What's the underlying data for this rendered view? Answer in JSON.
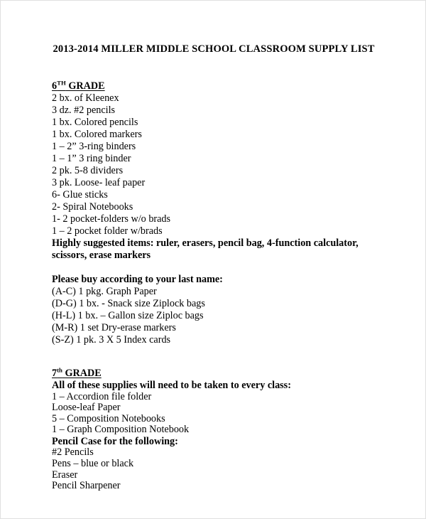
{
  "document": {
    "title": "2013-2014 MILLER MIDDLE SCHOOL CLASSROOM SUPPLY LIST",
    "sections": [
      {
        "id": "grade-6",
        "heading_number": "6",
        "heading_suffix": "TH",
        "heading_word": " GRADE",
        "items": [
          "2 bx. of Kleenex",
          "3 dz. #2 pencils",
          "1 bx. Colored pencils",
          "1 bx. Colored markers",
          "1 – 2” 3-ring binders",
          "1 – 1” 3 ring binder",
          "2 pk. 5-8 dividers",
          "3 pk. Loose- leaf paper",
          "6- Glue sticks",
          "2- Spiral Notebooks",
          "1- 2 pocket-folders w/o brads",
          "1 – 2 pocket folder w/brads"
        ],
        "suggested_note": "Highly suggested items: ruler, erasers, pencil bag, 4-function calculator, scissors, erase markers",
        "last_name_heading": "Please buy according to your last name:",
        "last_name_items": [
          "(A-C) 1 pkg. Graph Paper",
          "(D-G) 1 bx. - Snack size Ziplock bags",
          "(H-L) 1 bx. – Gallon size Ziploc bags",
          "(M-R) 1 set Dry-erase markers",
          "(S-Z) 1 pk. 3 X 5 Index cards"
        ]
      },
      {
        "id": "grade-7",
        "heading_number": "7",
        "heading_suffix": "th",
        "heading_word": " GRADE",
        "intro_note": "All of these supplies will need to be taken to every class:",
        "items": [
          "1 – Accordion file folder",
          "Loose-leaf Paper",
          "5 – Composition Notebooks",
          "1 – Graph Composition Notebook"
        ],
        "pencil_case_heading": "Pencil Case for the following:",
        "pencil_case_items": [
          "#2 Pencils",
          "Pens – blue or black",
          "Eraser",
          "Pencil Sharpener"
        ]
      }
    ]
  }
}
